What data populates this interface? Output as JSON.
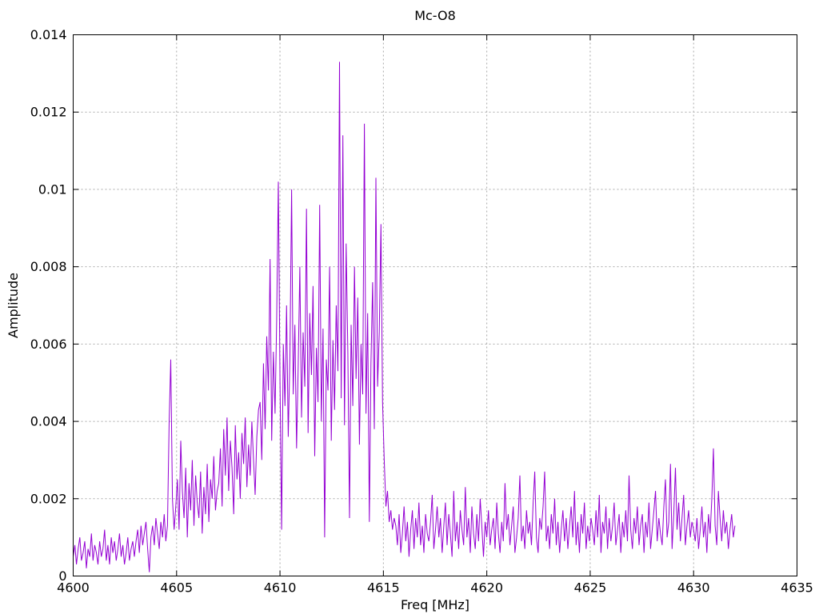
{
  "chart_data": {
    "type": "line",
    "title": "Mc-O8",
    "xlabel": "Freq [MHz]",
    "ylabel": "Amplitude",
    "xlim": [
      4600,
      4635
    ],
    "ylim": [
      0,
      0.014
    ],
    "xticks": {
      "values": [
        4600,
        4605,
        4610,
        4615,
        4620,
        4625,
        4630,
        4635
      ],
      "labels": [
        "4600",
        "4605",
        "4610",
        "4615",
        "4620",
        "4625",
        "4630",
        "4635"
      ]
    },
    "yticks": {
      "values": [
        0,
        0.002,
        0.004,
        0.006,
        0.008,
        0.01,
        0.012,
        0.014
      ],
      "labels": [
        "0",
        "0.002",
        "0.004",
        "0.006",
        "0.008",
        "0.01",
        "0.012",
        "0.014"
      ]
    },
    "grid": true,
    "legend": "none",
    "line_color": "#9400d3",
    "series": {
      "x_start": 4600,
      "x_step": 0.08,
      "values": [
        0.0005,
        0.0008,
        0.0003,
        0.0007,
        0.001,
        0.0004,
        0.0006,
        0.0009,
        0.0002,
        0.0007,
        0.0005,
        0.0011,
        0.0004,
        0.0008,
        0.0006,
        0.0003,
        0.0009,
        0.0005,
        0.0007,
        0.0012,
        0.0004,
        0.0008,
        0.0003,
        0.001,
        0.0006,
        0.0009,
        0.0004,
        0.0007,
        0.0011,
        0.0005,
        0.0008,
        0.0003,
        0.0006,
        0.001,
        0.0004,
        0.0007,
        0.0009,
        0.0005,
        0.0009,
        0.0012,
        0.0006,
        0.0013,
        0.0008,
        0.0011,
        0.0014,
        0.0007,
        0.0001,
        0.001,
        0.0013,
        0.0008,
        0.0015,
        0.0011,
        0.0007,
        0.0014,
        0.001,
        0.0016,
        0.0009,
        0.0013,
        0.004,
        0.0056,
        0.002,
        0.0012,
        0.0018,
        0.0025,
        0.0012,
        0.0035,
        0.0022,
        0.0015,
        0.0028,
        0.001,
        0.0024,
        0.0017,
        0.003,
        0.0013,
        0.0026,
        0.0019,
        0.0015,
        0.0027,
        0.0011,
        0.0023,
        0.0016,
        0.0029,
        0.0014,
        0.0025,
        0.002,
        0.0031,
        0.0017,
        0.0022,
        0.0024,
        0.0033,
        0.0018,
        0.0038,
        0.0026,
        0.0041,
        0.0022,
        0.0035,
        0.0028,
        0.0016,
        0.0039,
        0.0025,
        0.0032,
        0.002,
        0.0037,
        0.0029,
        0.0041,
        0.0023,
        0.0034,
        0.0026,
        0.004,
        0.003,
        0.0021,
        0.0036,
        0.0043,
        0.0045,
        0.003,
        0.0055,
        0.0038,
        0.0062,
        0.0048,
        0.0082,
        0.0035,
        0.0058,
        0.0042,
        0.0066,
        0.0102,
        0.005,
        0.0012,
        0.006,
        0.0044,
        0.007,
        0.0036,
        0.0057,
        0.01,
        0.0047,
        0.0065,
        0.0033,
        0.0054,
        0.008,
        0.0041,
        0.0063,
        0.0049,
        0.0095,
        0.0037,
        0.0068,
        0.0052,
        0.0075,
        0.0031,
        0.0059,
        0.0045,
        0.0096,
        0.004,
        0.0064,
        0.001,
        0.0056,
        0.0048,
        0.008,
        0.0035,
        0.0061,
        0.0043,
        0.007,
        0.0053,
        0.0133,
        0.0046,
        0.0114,
        0.0039,
        0.0086,
        0.0058,
        0.0015,
        0.0065,
        0.0044,
        0.008,
        0.0051,
        0.0072,
        0.0034,
        0.006,
        0.0047,
        0.0117,
        0.0042,
        0.0068,
        0.0014,
        0.0055,
        0.0076,
        0.0038,
        0.0103,
        0.0049,
        0.0063,
        0.0091,
        0.0045,
        0.003,
        0.0018,
        0.0022,
        0.0014,
        0.0017,
        0.0012,
        0.0015,
        0.0013,
        0.0008,
        0.0016,
        0.0006,
        0.0011,
        0.0018,
        0.0009,
        0.0014,
        0.0005,
        0.0012,
        0.0017,
        0.0007,
        0.0015,
        0.001,
        0.0019,
        0.0008,
        0.0013,
        0.0006,
        0.0016,
        0.0011,
        0.0009,
        0.0014,
        0.0021,
        0.0007,
        0.0012,
        0.0018,
        0.001,
        0.0015,
        0.0006,
        0.0013,
        0.0019,
        0.0008,
        0.0016,
        0.0011,
        0.0005,
        0.0022,
        0.0009,
        0.0014,
        0.0007,
        0.0017,
        0.0012,
        0.0008,
        0.0023,
        0.001,
        0.0015,
        0.0006,
        0.0018,
        0.0011,
        0.0007,
        0.0016,
        0.0009,
        0.002,
        0.0013,
        0.0005,
        0.0014,
        0.001,
        0.0017,
        0.0008,
        0.0012,
        0.0015,
        0.0007,
        0.0019,
        0.0011,
        0.0006,
        0.0014,
        0.0009,
        0.0024,
        0.0012,
        0.0016,
        0.0008,
        0.0013,
        0.0018,
        0.0006,
        0.001,
        0.0015,
        0.0026,
        0.0009,
        0.0013,
        0.0007,
        0.0017,
        0.0011,
        0.0014,
        0.0008,
        0.0019,
        0.0027,
        0.001,
        0.0006,
        0.0015,
        0.0012,
        0.0018,
        0.0027,
        0.0009,
        0.0013,
        0.0007,
        0.0016,
        0.0011,
        0.002,
        0.0008,
        0.0014,
        0.0006,
        0.0012,
        0.0017,
        0.0009,
        0.0015,
        0.0007,
        0.0013,
        0.0018,
        0.001,
        0.0022,
        0.0008,
        0.0014,
        0.0006,
        0.0016,
        0.0011,
        0.0019,
        0.0007,
        0.0013,
        0.0009,
        0.0015,
        0.0012,
        0.0008,
        0.0017,
        0.001,
        0.0021,
        0.0006,
        0.0014,
        0.0011,
        0.0018,
        0.0007,
        0.0015,
        0.0009,
        0.0013,
        0.0019,
        0.0008,
        0.0012,
        0.0016,
        0.0006,
        0.0014,
        0.001,
        0.0017,
        0.0009,
        0.0026,
        0.0012,
        0.0007,
        0.0015,
        0.0011,
        0.0018,
        0.0008,
        0.0013,
        0.0016,
        0.0006,
        0.0014,
        0.001,
        0.0019,
        0.0007,
        0.0012,
        0.0017,
        0.0022,
        0.0009,
        0.0015,
        0.0011,
        0.0008,
        0.0018,
        0.0025,
        0.001,
        0.0014,
        0.0029,
        0.0007,
        0.0016,
        0.0028,
        0.0012,
        0.0019,
        0.0009,
        0.0015,
        0.0021,
        0.0008,
        0.0013,
        0.0017,
        0.001,
        0.0014,
        0.0012,
        0.0009,
        0.0015,
        0.0007,
        0.0012,
        0.0018,
        0.001,
        0.0014,
        0.0006,
        0.0016,
        0.0011,
        0.002,
        0.0033,
        0.0013,
        0.0008,
        0.0022,
        0.0015,
        0.0009,
        0.0017,
        0.0011,
        0.0014,
        0.0007,
        0.0012,
        0.0016,
        0.001,
        0.0013
      ]
    }
  }
}
